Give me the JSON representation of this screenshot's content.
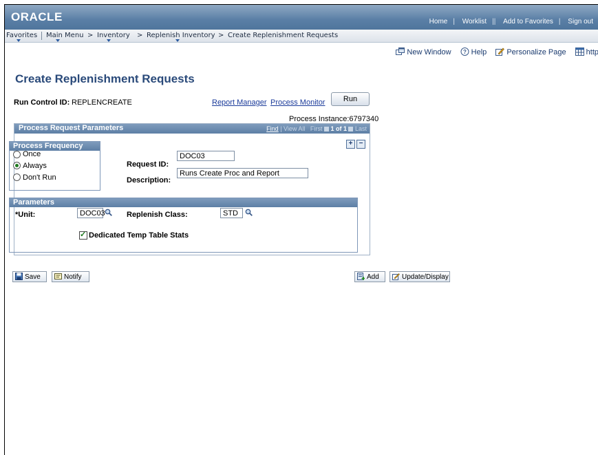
{
  "header": {
    "logo": "ORACLE",
    "links": [
      "Home",
      "Worklist",
      "Add to Favorites",
      "Sign out"
    ]
  },
  "breadcrumb": {
    "favorites": "Favorites",
    "main_menu": "Main Menu",
    "inventory": "Inventory",
    "replenish_inventory": "Replenish Inventory",
    "current": "Create Replenishment Requests",
    "separator": ">"
  },
  "toolbar": {
    "new_window": "New Window",
    "help": "Help",
    "personalize": "Personalize Page",
    "http": "http"
  },
  "page": {
    "title": "Create Replenishment Requests",
    "run_control_label": "Run Control ID:",
    "run_control_value": "REPLENCREATE",
    "report_manager": "Report Manager",
    "process_monitor": "Process Monitor",
    "run_button": "Run",
    "process_instance": "Process Instance:6797340"
  },
  "panel": {
    "title": "Process Request Parameters",
    "nav_find": "Find",
    "nav_view_all": "View All",
    "nav_first": "First",
    "nav_count": "1 of 1",
    "nav_last": "Last",
    "add_row": "+",
    "delete_row": "−"
  },
  "frequency": {
    "title": "Process Frequency",
    "options": [
      "Once",
      "Always",
      "Don't Run"
    ],
    "selected": "Always"
  },
  "request": {
    "id_label": "Request ID:",
    "id_value": "DOC03",
    "description_label": "Description:",
    "description_value": "Runs Create Proc and Report"
  },
  "parameters": {
    "title": "Parameters",
    "unit_label": "*Unit:",
    "unit_value": "DOC03",
    "replenish_class_label": "Replenish Class:",
    "replenish_class_value": "STD",
    "temp_table_label": "Dedicated Temp Table Stats",
    "temp_table_checked": true
  },
  "footer_buttons": {
    "save": "Save",
    "notify": "Notify",
    "add": "Add",
    "update_display": "Update/Display"
  }
}
